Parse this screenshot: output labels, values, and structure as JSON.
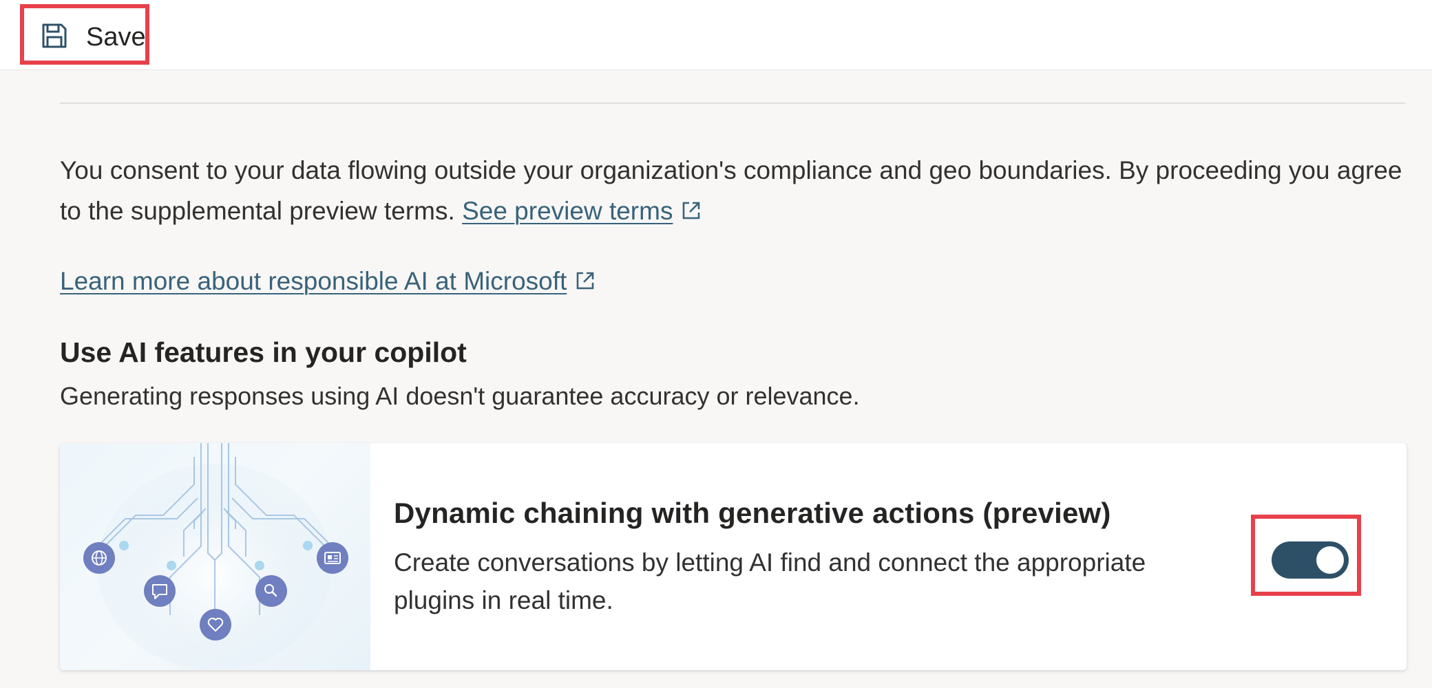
{
  "toolbar": {
    "save_label": "Save",
    "save_icon": "save-icon"
  },
  "consent": {
    "text": "You consent to your data flowing outside your organization's compliance and geo boundaries. By proceeding you agree to the supplemental preview terms. ",
    "link_label": "See preview terms",
    "link_icon": "external-link-icon"
  },
  "learn_more": {
    "link_label": "Learn more about responsible AI at Microsoft",
    "link_icon": "external-link-icon"
  },
  "section": {
    "title": "Use AI features in your copilot",
    "subtitle": "Generating responses using AI doesn't guarantee accuracy or relevance."
  },
  "card": {
    "title": "Dynamic chaining with generative actions (preview)",
    "description": "Create conversations by letting AI find and connect the appropriate plugins in real time.",
    "illustration_icons": [
      "globe-icon",
      "chat-icon",
      "heart-icon",
      "search-icon",
      "news-icon"
    ],
    "toggle_state": "on"
  },
  "colors": {
    "highlight": "#e8404a",
    "link": "#38627a",
    "toggle_on": "#2d5066",
    "icon_node": "#6f7fbf"
  }
}
